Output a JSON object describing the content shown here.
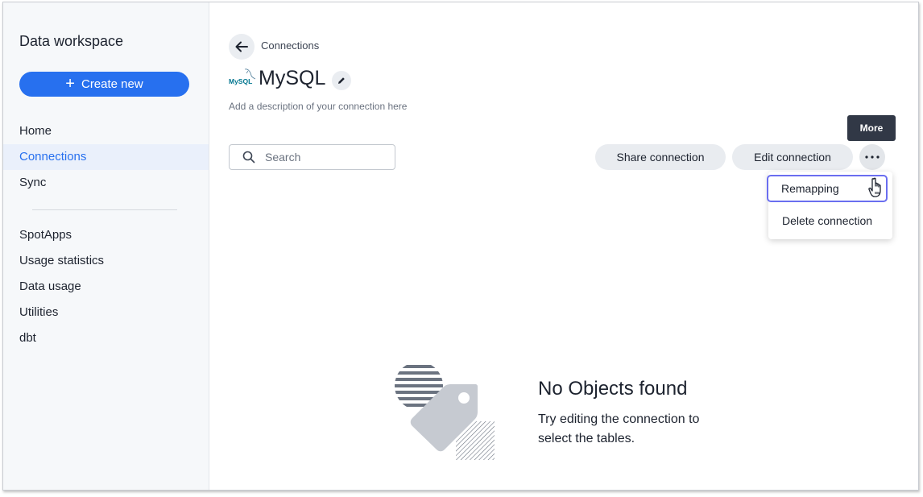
{
  "sidebar": {
    "title": "Data workspace",
    "create_label": "Create new",
    "nav_primary": [
      {
        "label": "Home",
        "active": false
      },
      {
        "label": "Connections",
        "active": true
      },
      {
        "label": "Sync",
        "active": false
      }
    ],
    "nav_secondary": [
      {
        "label": "SpotApps"
      },
      {
        "label": "Usage statistics"
      },
      {
        "label": "Data usage"
      },
      {
        "label": "Utilities"
      },
      {
        "label": "dbt"
      }
    ]
  },
  "header": {
    "breadcrumb": "Connections",
    "logo_text": "MySQL",
    "title": "MySQL",
    "description_placeholder": "Add a description of your connection here"
  },
  "toolbar": {
    "search_placeholder": "Search",
    "share_label": "Share connection",
    "edit_label": "Edit connection",
    "more_tooltip": "More"
  },
  "more_menu": {
    "items": [
      {
        "label": "Remapping",
        "focused": true
      },
      {
        "label": "Delete connection",
        "focused": false
      }
    ]
  },
  "empty_state": {
    "title": "No Objects found",
    "text": "Try editing the connection to select the tables."
  },
  "colors": {
    "accent": "#2770ef",
    "focus_ring": "#6a6ef0",
    "tooltip_bg": "#313846"
  }
}
